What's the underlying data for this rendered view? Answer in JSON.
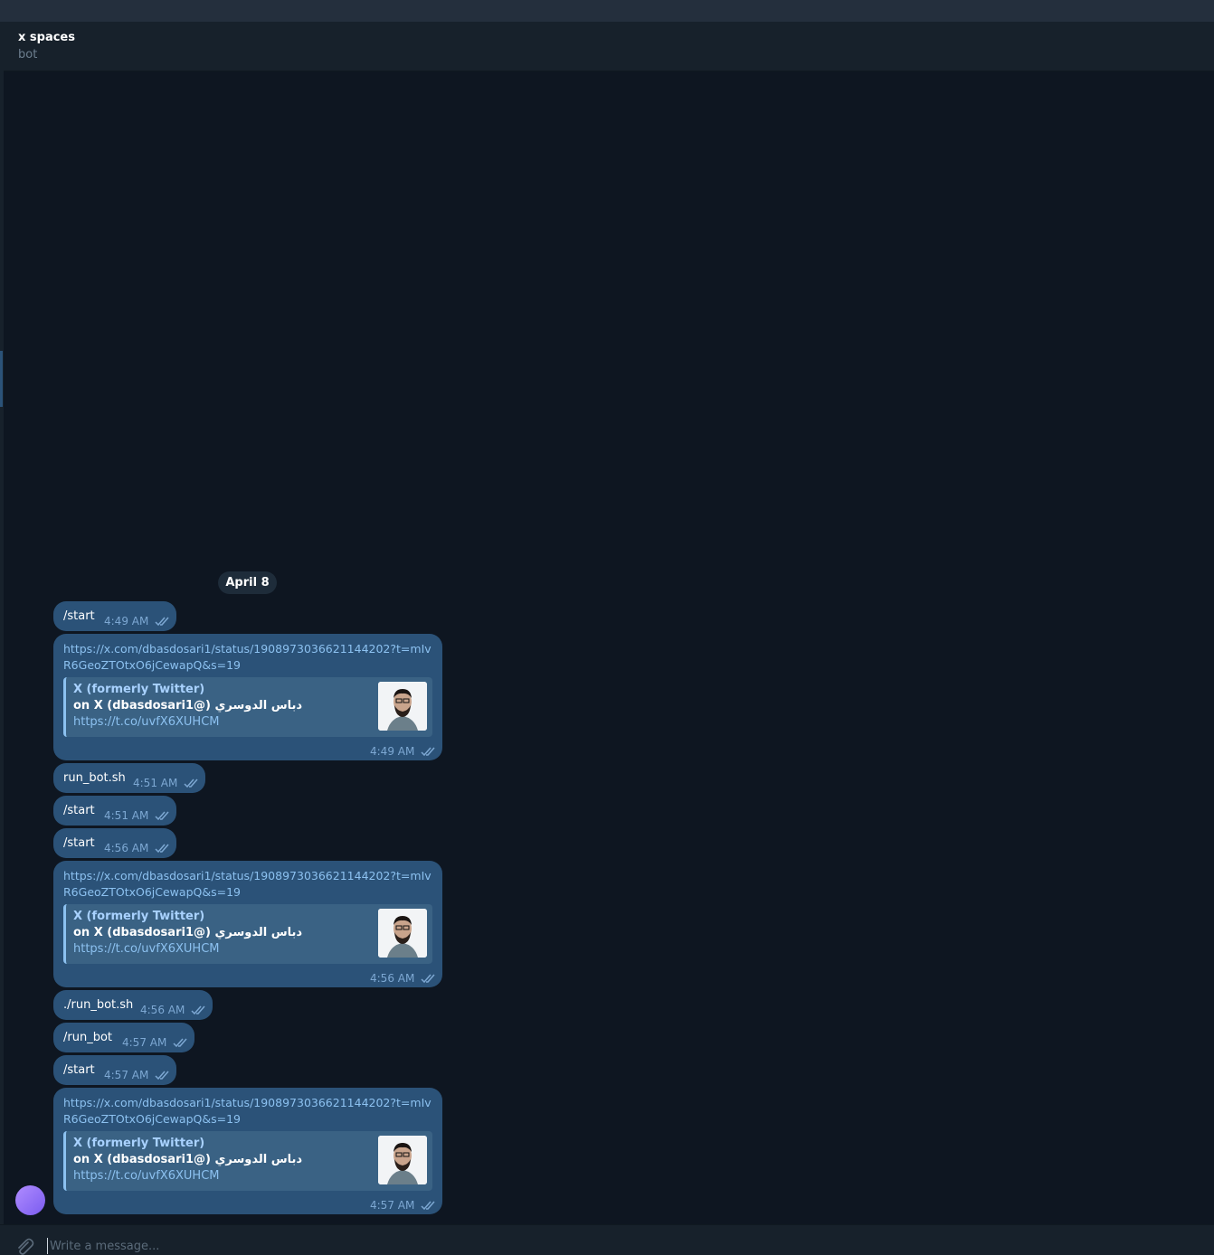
{
  "chat": {
    "title": "x spaces",
    "subtitle": "bot"
  },
  "date_separator": "April 8",
  "composer": {
    "placeholder": "Write a message..."
  },
  "preview": {
    "site": "X (formerly Twitter)",
    "title": "on X (dbasdosari1@) دباس الدوسري",
    "link": "https://t.co/uvfX6XUHCM"
  },
  "messages": [
    {
      "text": "/start",
      "time": "4:49 AM"
    },
    {
      "url": "https://x.com/dbasdosari1/status/1908973036621144202?t=mIvR6GeoZTOtxO6jCewapQ&s=19",
      "time": "4:49 AM"
    },
    {
      "text": "run_bot.sh",
      "time": "4:51 AM"
    },
    {
      "text": "/start",
      "time": "4:51 AM"
    },
    {
      "text": "/start",
      "time": "4:56 AM"
    },
    {
      "url": "https://x.com/dbasdosari1/status/1908973036621144202?t=mIvR6GeoZTOtxO6jCewapQ&s=19",
      "time": "4:56 AM"
    },
    {
      "text": "./run_bot.sh",
      "time": "4:56 AM"
    },
    {
      "text": "/run_bot",
      "time": "4:57 AM"
    },
    {
      "text": "/start",
      "time": "4:57 AM"
    },
    {
      "url": "https://x.com/dbasdosari1/status/1908973036621144202?t=mIvR6GeoZTOtxO6jCewapQ&s=19",
      "time": "4:57 AM"
    }
  ],
  "icons": {
    "attach": "paperclip-icon",
    "read": "double-check-icon",
    "thumb": "profile-photo"
  },
  "colors": {
    "background": "#0e1621",
    "bubble": "#2b5278",
    "link": "#8cc1f0",
    "header": "#17212b"
  }
}
